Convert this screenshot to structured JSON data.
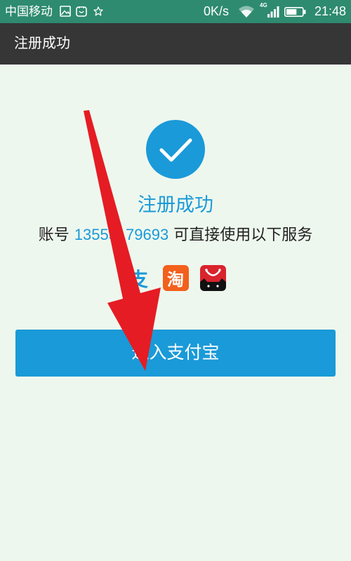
{
  "status_bar": {
    "carrier": "中国移动",
    "icons": [
      "gallery-icon",
      "app-notification-icon",
      "star-icon",
      "wifi-icon",
      "signal-icon",
      "battery-icon"
    ],
    "net_speed": "0K/s",
    "network_type": "4G",
    "signal_bars": 4,
    "battery_level": 0.65,
    "time": "21:48"
  },
  "title_bar": {
    "title": "注册成功"
  },
  "main": {
    "status_icon": "check-circle-icon",
    "success_title": "注册成功",
    "account_label": "账号",
    "account_number_start": "13555",
    "account_number_end": "79693",
    "services_text": "可直接使用以下服务",
    "services": [
      {
        "icon": "alipay-icon",
        "glyph": "支"
      },
      {
        "icon": "taobao-icon",
        "glyph": "淘"
      },
      {
        "icon": "tmall-icon"
      }
    ],
    "enter_button_label": "进入支付宝"
  },
  "annotation": {
    "icon": "red-arrow-annotation"
  },
  "colors": {
    "status_bar": "#2e8b6f",
    "title_bar": "#363636",
    "background": "#eef7ee",
    "accent_blue": "#1a9ad8",
    "taobao_orange": "#f2601c",
    "tmall_red": "#d9232d",
    "arrow_red": "#e51c23"
  }
}
